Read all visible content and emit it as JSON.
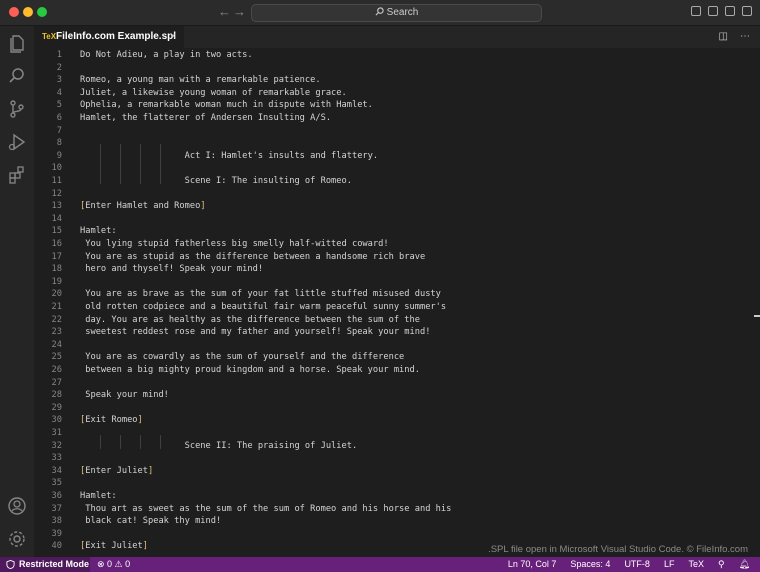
{
  "window": {
    "search_label": "Search",
    "tab": {
      "icon_text": "TeX",
      "title": "FileInfo.com Example.spl",
      "close": "×"
    }
  },
  "editor": {
    "lines": [
      {
        "n": "1",
        "t": "Do Not Adieu, a play in two acts."
      },
      {
        "n": "2",
        "t": ""
      },
      {
        "n": "3",
        "t": "Romeo, a young man with a remarkable patience."
      },
      {
        "n": "4",
        "t": "Juliet, a likewise young woman of remarkable grace."
      },
      {
        "n": "5",
        "t": "Ophelia, a remarkable woman much in dispute with Hamlet."
      },
      {
        "n": "6",
        "t": "Hamlet, the flatterer of Andersen Insulting A/S."
      },
      {
        "n": "7",
        "t": ""
      },
      {
        "n": "8",
        "t": ""
      },
      {
        "n": "9",
        "t": "                    Act I: Hamlet's insults and flattery."
      },
      {
        "n": "10",
        "t": ""
      },
      {
        "n": "11",
        "t": "                    Scene I: The insulting of Romeo."
      },
      {
        "n": "12",
        "t": ""
      },
      {
        "n": "13",
        "pre": "",
        "open": "[",
        "mid": "Enter Hamlet and Romeo",
        "close": "]"
      },
      {
        "n": "14",
        "t": ""
      },
      {
        "n": "15",
        "t": "Hamlet:"
      },
      {
        "n": "16",
        "t": " You lying stupid fatherless big smelly half-witted coward!"
      },
      {
        "n": "17",
        "t": " You are as stupid as the difference between a handsome rich brave"
      },
      {
        "n": "18",
        "t": " hero and thyself! Speak your mind!"
      },
      {
        "n": "19",
        "t": ""
      },
      {
        "n": "20",
        "t": " You are as brave as the sum of your fat little stuffed misused dusty"
      },
      {
        "n": "21",
        "t": " old rotten codpiece and a beautiful fair warm peaceful sunny summer's"
      },
      {
        "n": "22",
        "t": " day. You are as healthy as the difference between the sum of the"
      },
      {
        "n": "23",
        "t": " sweetest reddest rose and my father and yourself! Speak your mind!"
      },
      {
        "n": "24",
        "t": ""
      },
      {
        "n": "25",
        "t": " You are as cowardly as the sum of yourself and the difference"
      },
      {
        "n": "26",
        "t": " between a big mighty proud kingdom and a horse. Speak your mind."
      },
      {
        "n": "27",
        "t": ""
      },
      {
        "n": "28",
        "t": " Speak your mind!"
      },
      {
        "n": "29",
        "t": ""
      },
      {
        "n": "30",
        "pre": "",
        "open": "[",
        "mid": "Exit Romeo",
        "close": "]"
      },
      {
        "n": "31",
        "t": ""
      },
      {
        "n": "32",
        "t": "                    Scene II: The praising of Juliet."
      },
      {
        "n": "33",
        "t": ""
      },
      {
        "n": "34",
        "pre": "",
        "open": "[",
        "mid": "Enter Juliet",
        "close": "]"
      },
      {
        "n": "35",
        "t": ""
      },
      {
        "n": "36",
        "t": "Hamlet:"
      },
      {
        "n": "37",
        "t": " Thou art as sweet as the sum of the sum of Romeo and his horse and his"
      },
      {
        "n": "38",
        "t": " black cat! Speak thy mind!"
      },
      {
        "n": "39",
        "t": ""
      },
      {
        "n": "40",
        "pre": "",
        "open": "[",
        "mid": "Exit Juliet",
        "close": "]"
      }
    ]
  },
  "watermark": ".SPL file open in Microsoft Visual Studio Code. © FileInfo.com",
  "statusbar": {
    "restricted": "Restricted Mode",
    "problems": "⊗ 0 ⚠ 0",
    "position": "Ln 70, Col 7",
    "spaces": "Spaces: 4",
    "encoding": "UTF-8",
    "eol": "LF",
    "language": "TeX"
  },
  "colors": {
    "accent": "#68217a",
    "bracket": "#e5c07b",
    "background": "#1e1e1e"
  }
}
